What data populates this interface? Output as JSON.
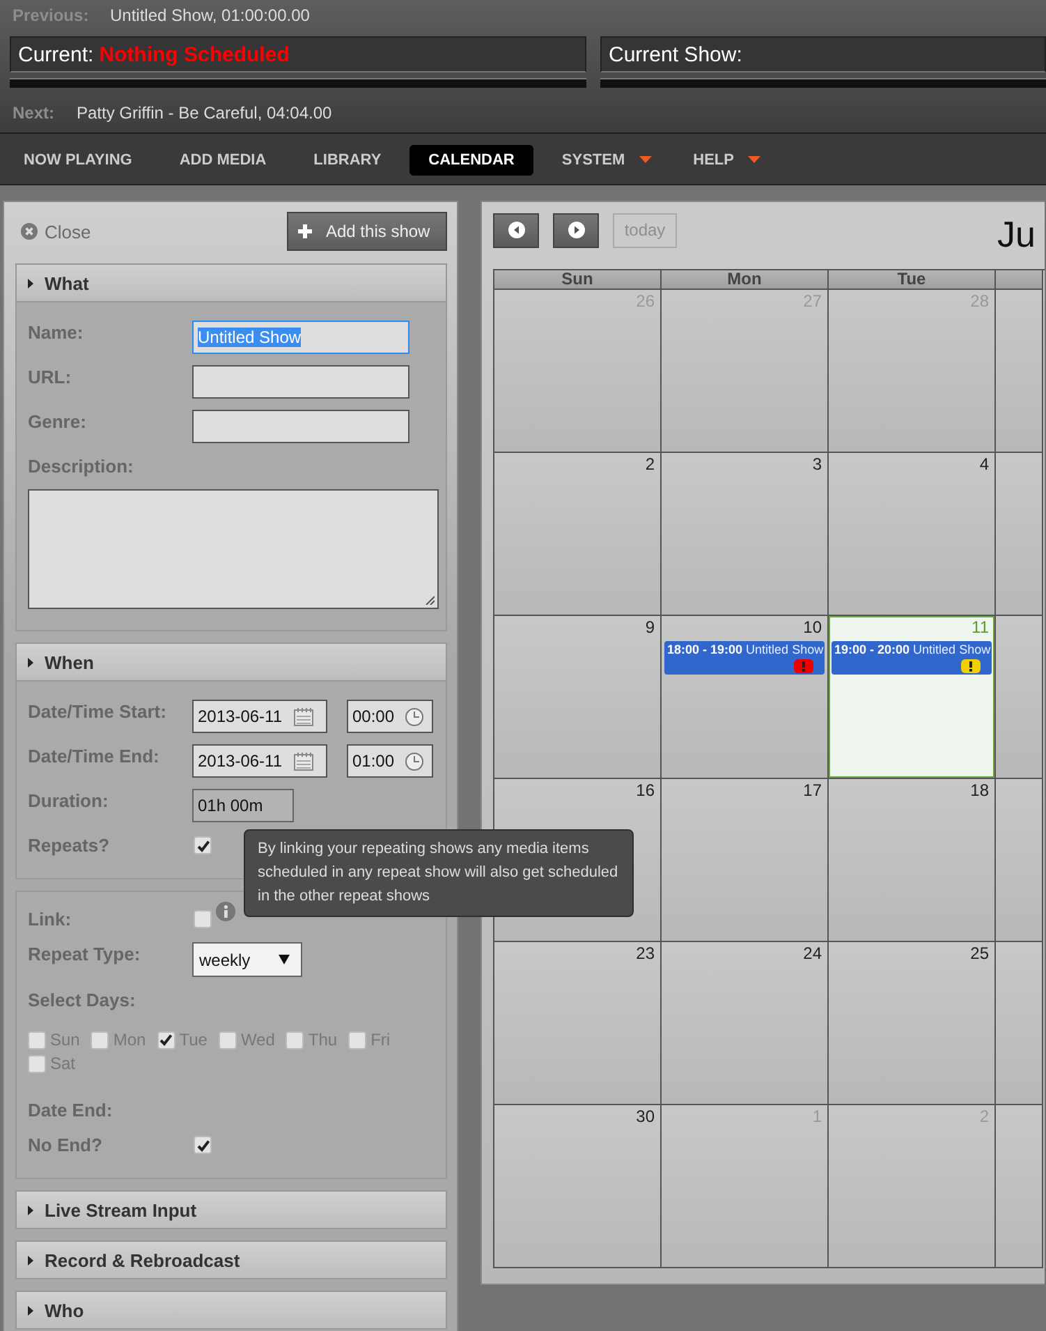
{
  "now_playing": {
    "previous_label": "Previous:",
    "previous": "Untitled Show, 01:00:00.00",
    "current_label": "Current:",
    "current": "Nothing Scheduled",
    "current_progress": {
      "level": 0
    },
    "current_show_label": "Current Show:",
    "current_show_progress": {
      "level": 0
    },
    "next_label": "Next:",
    "next": "Patty Griffin - Be Careful, 04:04.00"
  },
  "nav": [
    {
      "label": "NOW PLAYING",
      "selected": false,
      "has_menu": false
    },
    {
      "label": "ADD MEDIA",
      "selected": false,
      "has_menu": false
    },
    {
      "label": "LIBRARY",
      "selected": false,
      "has_menu": false
    },
    {
      "label": "CALENDAR",
      "selected": true,
      "has_menu": false
    },
    {
      "label": "SYSTEM",
      "selected": false,
      "has_menu": true
    },
    {
      "label": "HELP",
      "selected": false,
      "has_menu": true
    }
  ],
  "show_form": {
    "close": "Close",
    "add_button": "Add this show",
    "sections": [
      {
        "title": "What",
        "expanded": true,
        "fields": [
          {
            "kind": "text",
            "label": "Name:",
            "value": "Untitled Show",
            "focused": true
          },
          {
            "kind": "text",
            "label": "URL:",
            "focused": false
          },
          {
            "kind": "text",
            "label": "Genre:",
            "focused": false
          },
          {
            "kind": "textarea",
            "label": "Description:"
          }
        ]
      },
      {
        "title": "When",
        "expanded": true,
        "fields": [
          {
            "kind": "datetime",
            "label": "Date/Time Start:",
            "date": "2013-06-11",
            "time": "00:00"
          },
          {
            "kind": "datetime",
            "label": "Date/Time End:",
            "date": "2013-06-11",
            "time": "01:00"
          },
          {
            "kind": "readonly",
            "label": "Duration:",
            "value": "01h 00m"
          },
          {
            "kind": "checkbox",
            "label": "Repeats?",
            "checked": true,
            "info": false
          }
        ]
      },
      {
        "expanded": true,
        "fields": [
          {
            "kind": "checkbox",
            "label": "Link:",
            "checked": false,
            "info": true
          },
          {
            "kind": "select",
            "label": "Repeat Type:",
            "value": "weekly"
          },
          {
            "kind": "days",
            "label": "Select Days:",
            "days": [
              {
                "label": "Sun",
                "checked": false
              },
              {
                "label": "Mon",
                "checked": false
              },
              {
                "label": "Tue",
                "checked": true
              },
              {
                "label": "Wed",
                "checked": false
              },
              {
                "label": "Thu",
                "checked": false
              },
              {
                "label": "Fri",
                "checked": false
              },
              {
                "label": "Sat",
                "checked": false
              }
            ]
          },
          {
            "kind": "heading",
            "label": "Date End:"
          },
          {
            "kind": "checkbox",
            "label": "No End?",
            "checked": true,
            "info": false
          }
        ]
      },
      {
        "title": "Live Stream Input",
        "expanded": false
      },
      {
        "title": "Record & Rebroadcast",
        "expanded": false
      },
      {
        "title": "Who",
        "expanded": false
      }
    ]
  },
  "tooltip": {
    "text": "By linking your repeating shows any media items scheduled in any repeat show will also get scheduled in the other repeat shows"
  },
  "calendar": {
    "title": "Ju",
    "today_button": "today",
    "today_disabled": true,
    "weekdays": [
      "Sun",
      "Mon",
      "Tue"
    ],
    "weeks": [
      [
        {
          "day": "26",
          "other_month": true,
          "today": false
        },
        {
          "day": "27",
          "other_month": true,
          "today": false
        },
        {
          "day": "28",
          "other_month": true,
          "today": false
        }
      ],
      [
        {
          "day": "2",
          "other_month": false,
          "today": false
        },
        {
          "day": "3",
          "other_month": false,
          "today": false
        },
        {
          "day": "4",
          "other_month": false,
          "today": false
        }
      ],
      [
        {
          "day": "9",
          "other_month": false,
          "today": false
        },
        {
          "day": "10",
          "other_month": false,
          "today": false,
          "events": [
            {
              "text": "**18:00 - 19:00** Untitled Show",
              "color": "#ee0000"
            }
          ]
        },
        {
          "day": "11",
          "other_month": false,
          "today": true,
          "events": [
            {
              "text": "**19:00 - 20:00** Untitled Show",
              "color": "#f2d000"
            }
          ]
        }
      ],
      [
        {
          "day": "16",
          "other_month": false,
          "today": false
        },
        {
          "day": "17",
          "other_month": false,
          "today": false
        },
        {
          "day": "18",
          "other_month": false,
          "today": false
        }
      ],
      [
        {
          "day": "23",
          "other_month": false,
          "today": false
        },
        {
          "day": "24",
          "other_month": false,
          "today": false
        },
        {
          "day": "25",
          "other_month": false,
          "today": false
        }
      ],
      [
        {
          "day": "30",
          "other_month": false,
          "today": false
        },
        {
          "day": "1",
          "other_month": true,
          "today": false
        },
        {
          "day": "2",
          "other_month": true,
          "today": false
        }
      ]
    ]
  }
}
